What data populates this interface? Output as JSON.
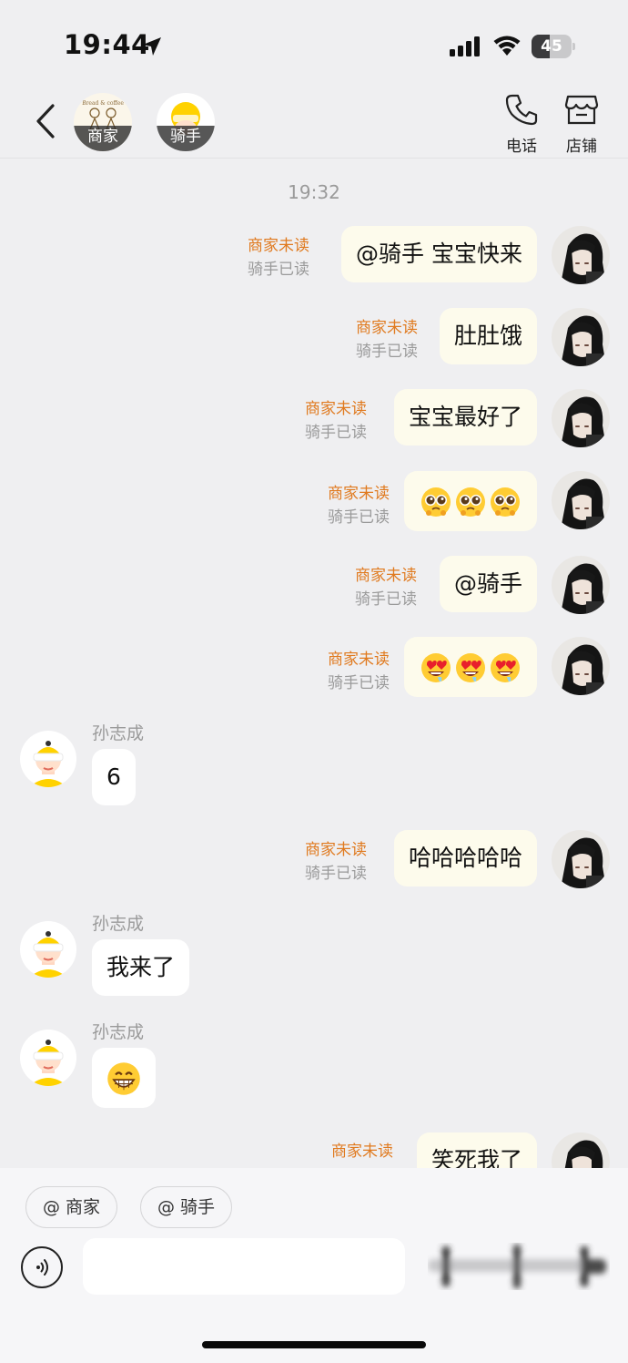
{
  "status_bar": {
    "time": "19:44",
    "battery": "45",
    "battery_level": 0.45
  },
  "header": {
    "merchant_label": "商家",
    "rider_label": "骑手",
    "phone_label": "电话",
    "store_label": "店铺"
  },
  "chat": {
    "time_label": "19:32",
    "messages": [
      {
        "text": "@骑手 宝宝快来",
        "status_unread": "商家未读",
        "status_read": "骑手已读"
      },
      {
        "text": "肚肚饿",
        "status_unread": "商家未读",
        "status_read": "骑手已读"
      },
      {
        "text": "宝宝最好了",
        "status_unread": "商家未读",
        "status_read": "骑手已读"
      },
      {
        "emoji": "pleading-face x3",
        "status_unread": "商家未读",
        "status_read": "骑手已读"
      },
      {
        "text": "@骑手",
        "status_unread": "商家未读",
        "status_read": "骑手已读"
      },
      {
        "emoji": "heart-eyes-face x3",
        "status_unread": "商家未读",
        "status_read": "骑手已读"
      },
      {
        "sender": "孙志成",
        "text": "6"
      },
      {
        "text": "哈哈哈哈哈",
        "status_unread": "商家未读",
        "status_read": "骑手已读"
      },
      {
        "sender": "孙志成",
        "text": "我来了"
      },
      {
        "sender": "孙志成",
        "emoji": "grinning-face"
      },
      {
        "text": "笑死我了",
        "status_unread": "商家未读"
      }
    ]
  },
  "bottom": {
    "mention_merchant": "@ 商家",
    "mention_rider": "@ 骑手"
  },
  "colors": {
    "background": "#efeff1",
    "self_bubble": "#fdfbec",
    "other_bubble": "#ffffff",
    "unread": "#e07a1f",
    "read": "#9a9a9a"
  }
}
